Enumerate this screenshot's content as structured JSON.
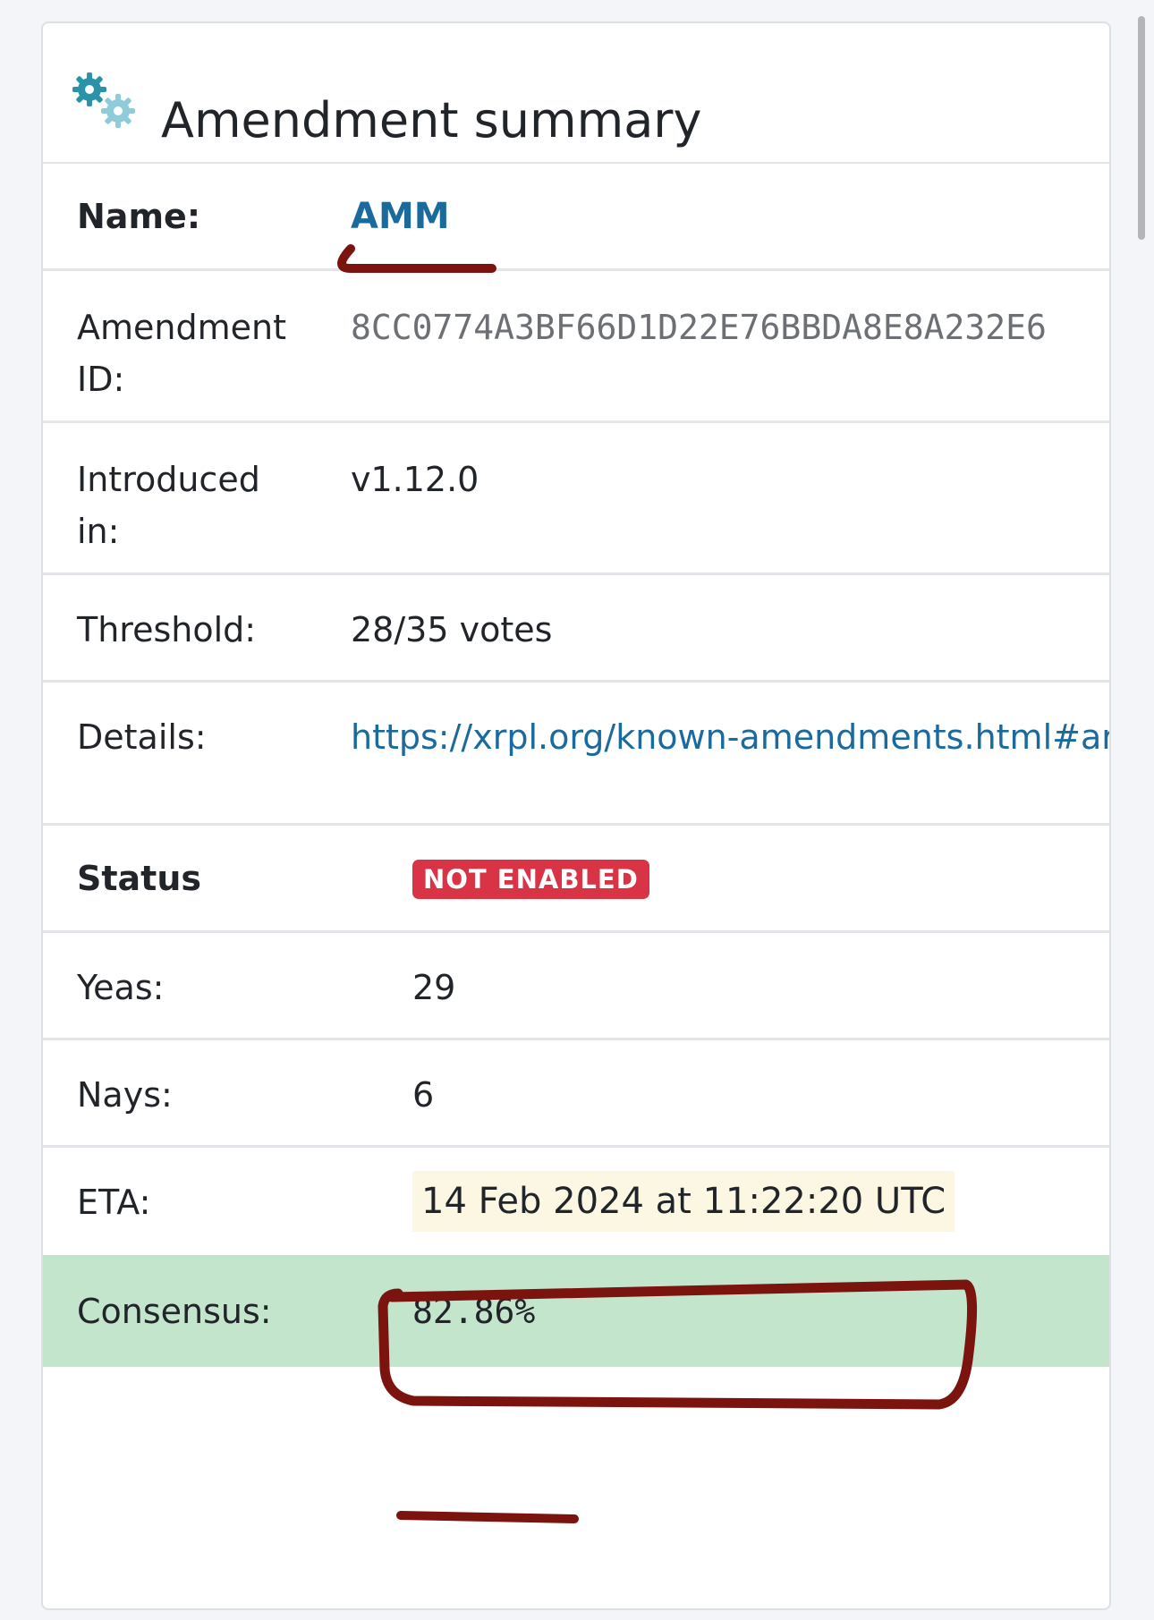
{
  "card": {
    "title": "Amendment summary",
    "icon": "gears-icon"
  },
  "summary": {
    "name_label": "Name:",
    "name_value": "AMM",
    "amendment_id_label": "Amendment\nID:",
    "amendment_id_value": "8CC0774A3BF66D1D22E76BBDA8E8A232E6",
    "introduced_label": "Introduced\nin:",
    "introduced_value": "v1.12.0",
    "threshold_label": "Threshold:",
    "threshold_value": "28/35 votes",
    "details_label": "Details:",
    "details_value": "https://xrpl.org/known-amendments.html#ar"
  },
  "status": {
    "status_label": "Status",
    "status_badge": "NOT ENABLED",
    "yeas_label": "Yeas:",
    "yeas_value": "29",
    "nays_label": "Nays:",
    "nays_value": "6",
    "eta_label": "ETA:",
    "eta_value": "14 Feb 2024 at 11:22:20 UTC",
    "consensus_label": "Consensus:",
    "consensus_value": "82.86%"
  },
  "colors": {
    "link": "#1b6a9e",
    "badge_red": "#d93445",
    "consensus_green": "#c3e5cc",
    "eta_highlight": "#fbf7e2",
    "annotation_ink": "#7b130f"
  }
}
